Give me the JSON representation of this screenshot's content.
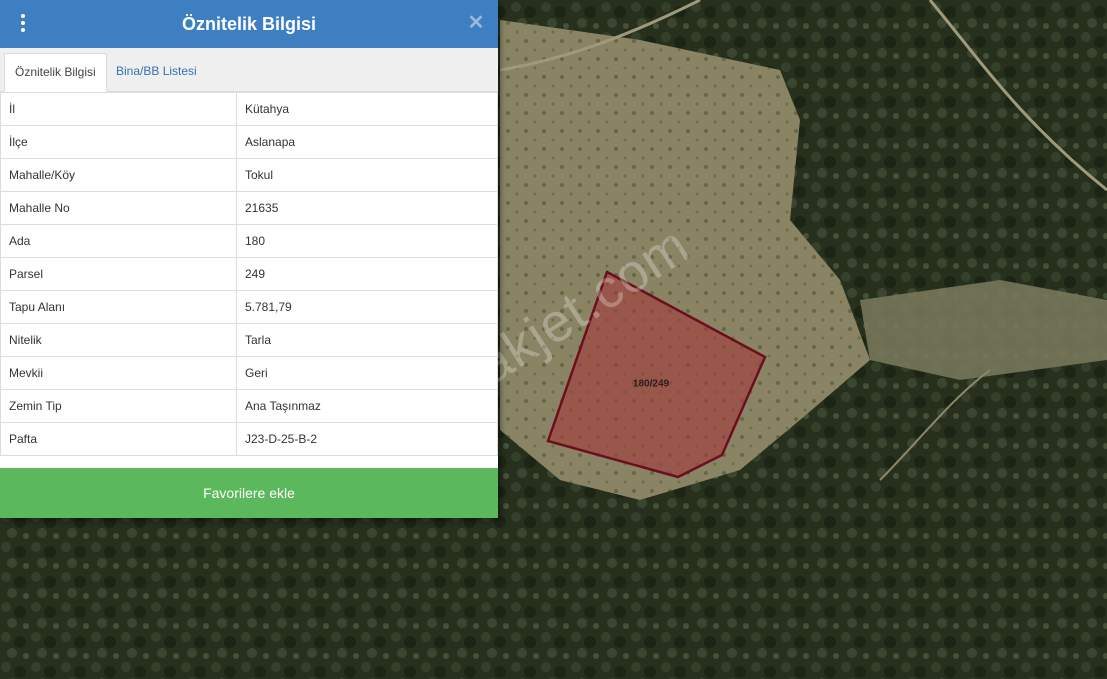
{
  "panel": {
    "title": "Öznitelik Bilgisi",
    "icons": {
      "menu": "vertical-dots-icon",
      "close": "close-icon"
    },
    "tabs": [
      {
        "label": "Öznitelik Bilgisi",
        "active": true
      },
      {
        "label": "Bina/BB Listesi",
        "active": false
      }
    ],
    "rows": [
      {
        "key": "İl",
        "value": "Kütahya"
      },
      {
        "key": "İlçe",
        "value": "Aslanapa"
      },
      {
        "key": "Mahalle/Köy",
        "value": "Tokul"
      },
      {
        "key": "Mahalle No",
        "value": "21635"
      },
      {
        "key": "Ada",
        "value": "180"
      },
      {
        "key": "Parsel",
        "value": "249"
      },
      {
        "key": "Tapu Alanı",
        "value": "5.781,79"
      },
      {
        "key": "Nitelik",
        "value": "Tarla"
      },
      {
        "key": "Mevkii",
        "value": "Geri"
      },
      {
        "key": "Zemin Tip",
        "value": "Ana Taşınmaz"
      },
      {
        "key": "Pafta",
        "value": "J23-D-25-B-2"
      }
    ],
    "button": "Favorilere ekle"
  },
  "map": {
    "parcel_label": "180/249",
    "watermark": "emlakjet.com",
    "colors": {
      "parcel_fill": "#a33a3a",
      "parcel_stroke": "#6b0f1f",
      "header": "#3d7fc1",
      "button": "#5cb85c"
    }
  }
}
